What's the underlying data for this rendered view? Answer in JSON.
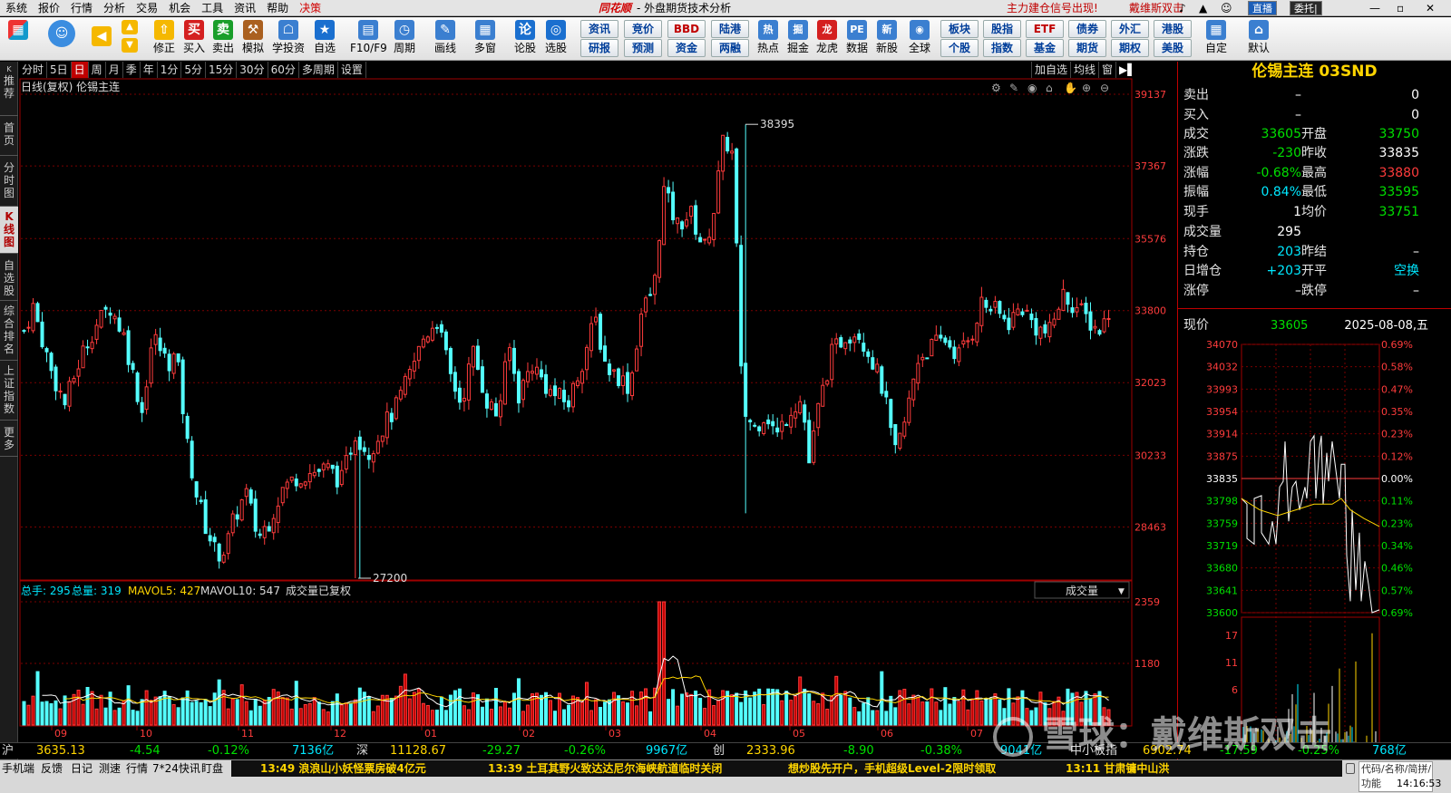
{
  "menubar": {
    "items": [
      "系统",
      "报价",
      "行情",
      "分析",
      "交易",
      "机会",
      "工具",
      "资讯",
      "帮助",
      "决策"
    ],
    "brand": "同花顺",
    "app_title": "- 外盘期货技术分析",
    "promo": "主力建仓信号出现!",
    "user": "戴维斯双击",
    "btn_live": "直播",
    "btn_trade": "委托|"
  },
  "toolbar": {
    "tools": [
      "修正",
      "买入",
      "卖出",
      "模拟",
      "学投资",
      "自选",
      "F10/F9",
      "周期",
      "画线",
      "多窗",
      "论股",
      "选股"
    ],
    "grid1": [
      "资讯",
      "竞价",
      "BBD",
      "陆港",
      "研报",
      "预测",
      "资金",
      "两融"
    ],
    "tools2": [
      "热点",
      "掘金",
      "龙虎",
      "数据",
      "新股",
      "全球"
    ],
    "grid2": [
      "板块",
      "股指",
      "ETF",
      "债券",
      "外汇",
      "港股",
      "个股",
      "指数",
      "基金",
      "期货",
      "期权",
      "美股"
    ],
    "tools3": [
      "自定",
      "默认"
    ]
  },
  "sidetabs": [
    "推荐",
    "首页",
    "分时图",
    "K线图",
    "自选股",
    "综合排名",
    "上证指数",
    "更多"
  ],
  "periodbar": {
    "items": [
      "分时",
      "5日",
      "日",
      "周",
      "月",
      "季",
      "年",
      "1分",
      "5分",
      "15分",
      "30分",
      "60分",
      "多周期",
      "设置"
    ],
    "right": [
      "加自选",
      "均线",
      "窗"
    ],
    "active_index": 2
  },
  "kchart": {
    "title": "日线(复权) 伦锡主连",
    "high_label": "38395",
    "low_label": "27200",
    "price_axis": [
      "39137",
      "37367",
      "35576",
      "33800",
      "32023",
      "30233",
      "28463"
    ],
    "months": [
      "09",
      "10",
      "11",
      "12",
      "01",
      "02",
      "03",
      "04",
      "05",
      "06",
      "07"
    ],
    "legend": {
      "total_hand": "总手: 295",
      "total_vol": "总量: 319",
      "mavol5": "MAVOL5: 427",
      "mavol10": "MAVOL10: 547",
      "note": "成交量已复权"
    },
    "vol_selector": "成交量",
    "vol_axis": [
      "2359",
      "1180"
    ]
  },
  "chart_data": {
    "type": "candlestick",
    "title": "日线(复权) 伦锡主连",
    "ylim": [
      27200,
      39137
    ],
    "x_months": [
      "09",
      "10",
      "11",
      "12",
      "01",
      "02",
      "03",
      "04",
      "05",
      "06",
      "07"
    ],
    "max_high": 38395,
    "min_low": 27200,
    "last": {
      "open": 33750,
      "high": 33880,
      "low": 33595,
      "close": 33605
    },
    "volume": {
      "series": [
        {
          "name": "成交量"
        },
        {
          "name": "MAVOL5",
          "last": 427
        },
        {
          "name": "MAVOL10",
          "last": 547
        }
      ],
      "last": 295,
      "ylim": [
        0,
        2359
      ]
    }
  },
  "quote": {
    "name": "伦锡主连 03SND",
    "rows": [
      {
        "l1": "卖出",
        "v1": "–",
        "v2": "0"
      },
      {
        "l1": "买入",
        "v1": "–",
        "v2": "0"
      },
      {
        "l1": "成交",
        "v1": "33605",
        "l2": "开盘",
        "v2": "33750"
      },
      {
        "l1": "涨跌",
        "v1": "-230",
        "l2": "昨收",
        "v2": "33835"
      },
      {
        "l1": "涨幅",
        "v1": "-0.68%",
        "l2": "最高",
        "v2": "33880"
      },
      {
        "l1": "振幅",
        "v1": "0.84%",
        "l2": "最低",
        "v2": "33595"
      },
      {
        "l1": "现手",
        "v1": "1",
        "l2": "均价",
        "v2": "33751"
      },
      {
        "l1": "成交量",
        "v1": "295"
      },
      {
        "l1": "持仓",
        "v1": "203",
        "l2": "昨结",
        "v2": "–"
      },
      {
        "l1": "日增仓",
        "v1": "+203",
        "l2": "开平",
        "v2": "空换"
      },
      {
        "l1": "涨停",
        "v1": "–",
        "l2": "跌停",
        "v2": "–"
      }
    ],
    "now_label": "现价",
    "now_price": "33605",
    "now_date": "2025-08-08,五"
  },
  "mini": {
    "prices": [
      "34070",
      "34032",
      "33993",
      "33954",
      "33914",
      "33875",
      "33835",
      "33798",
      "33759",
      "33719",
      "33680",
      "33641",
      "33600"
    ],
    "pcts": [
      "0.69%",
      "0.58%",
      "0.47%",
      "0.35%",
      "0.23%",
      "0.12%",
      "0.00%",
      "0.11%",
      "0.23%",
      "0.34%",
      "0.46%",
      "0.57%",
      "0.69%"
    ],
    "vol_axis": [
      "17",
      "11",
      "6"
    ]
  },
  "indexbar": {
    "sh": {
      "name": "沪",
      "price": "3635.13",
      "chg": "-4.54",
      "pct": "-0.12%",
      "amt": "7136亿"
    },
    "sz": {
      "name": "深",
      "price": "11128.67",
      "chg": "-29.27",
      "pct": "-0.26%",
      "amt": "9967亿"
    },
    "cy": {
      "name": "创",
      "price": "2333.96",
      "chg": "-8.90",
      "pct": "-0.38%",
      "amt": "9041亿"
    },
    "zx": {
      "name": "中小板指",
      "price": "6902.74",
      "chg": "-17.59",
      "pct": "-0.25%",
      "amt": "768亿"
    }
  },
  "statusbar": {
    "items": [
      "手机端",
      "反馈",
      "日记",
      "测速",
      "行情",
      "7*24快讯",
      "盯盘"
    ],
    "ticker": [
      "13:49 浪浪山小妖怪票房破4亿元",
      "13:39 土耳其野火致达达尼尔海峡航道临时关闭",
      "想炒股先开户，手机超级Level-2限时领取",
      "13:11 甘肃镛中山洪"
    ],
    "search": "代码/名称/简拼/功能",
    "time": "14:16:53"
  },
  "watermark": "雪球：戴维斯双击"
}
